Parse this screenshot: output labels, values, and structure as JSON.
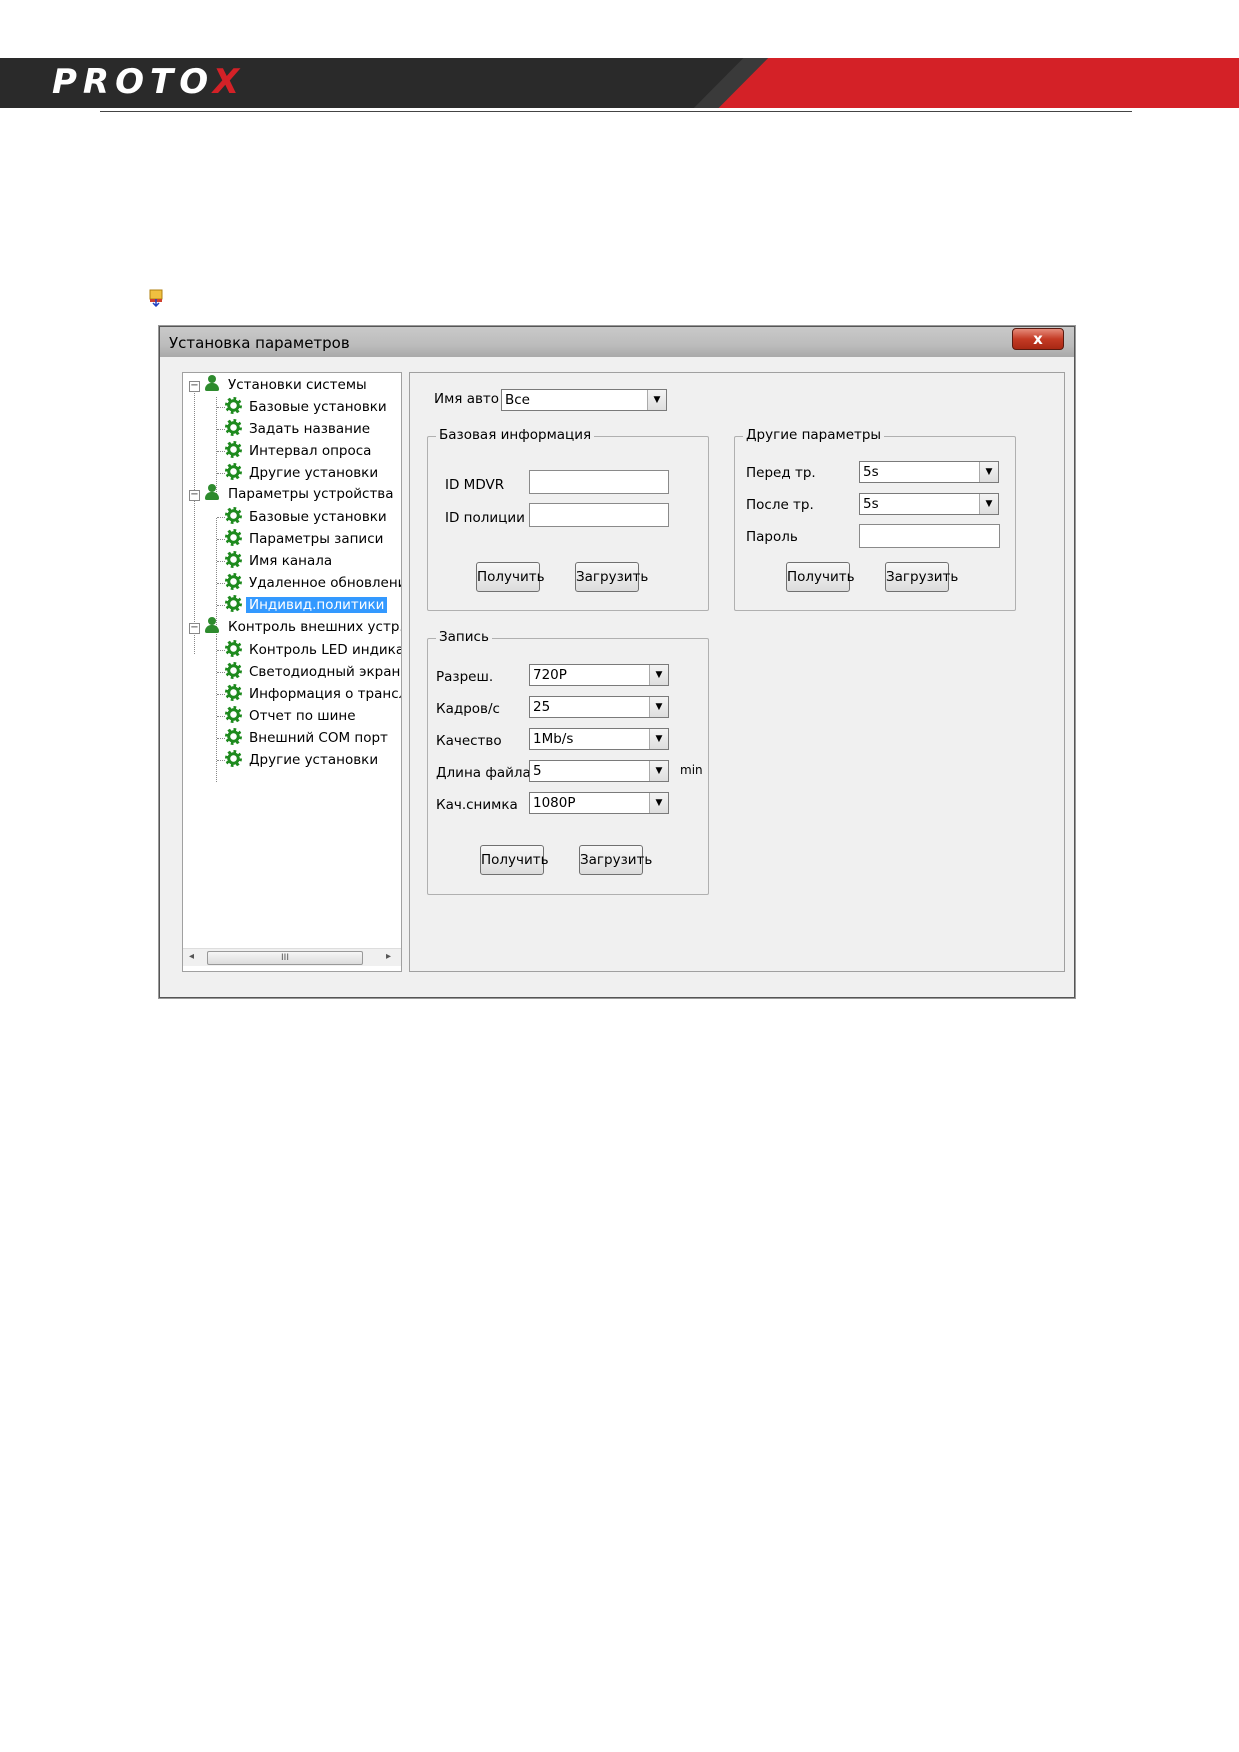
{
  "header": {
    "logo_text": "PROTO",
    "logo_x": "X"
  },
  "window": {
    "title": "Установка параметров",
    "close_label": "x"
  },
  "tree": {
    "groups": [
      {
        "label": "Установки системы",
        "items": [
          "Базовые установки",
          "Задать название",
          "Интервал опроса",
          "Другие установки"
        ]
      },
      {
        "label": "Параметры устройства",
        "items": [
          "Базовые установки",
          "Параметры записи",
          "Имя канала",
          "Удаленное обновление",
          "Индивид.политики"
        ]
      },
      {
        "label": "Контроль внешних устр.",
        "items": [
          "Контроль LED индикац",
          "Светодиодный экран",
          "Информация о трансло",
          "Отчет по шине",
          "Внешний COM порт",
          "Другие установки"
        ]
      }
    ],
    "selected": "Индивид.политики",
    "scroll_thumb": "III"
  },
  "panel": {
    "car_name_label": "Имя авто",
    "car_name_value": "Все",
    "basic": {
      "legend": "Базовая информация",
      "mdvr_label": "ID MDVR",
      "police_label": "ID полиции",
      "get_label": "Получить",
      "load_label": "Загрузить"
    },
    "other": {
      "legend": "Другие параметры",
      "pre_label": "Перед тр.",
      "pre_value": "5s",
      "post_label": "После тр.",
      "post_value": "5s",
      "password_label": "Пароль",
      "get_label": "Получить",
      "load_label": "Загрузить"
    },
    "record": {
      "legend": "Запись",
      "res_label": "Разреш.",
      "res_value": "720P",
      "fps_label": "Кадров/с",
      "fps_value": "25",
      "quality_label": "Качество",
      "quality_value": "1Mb/s",
      "filelen_label": "Длина файла",
      "filelen_value": "5",
      "filelen_unit": "min",
      "snapshot_label": "Кач.снимка",
      "snapshot_value": "1080P",
      "get_label": "Получить",
      "load_label": "Загрузить"
    }
  }
}
